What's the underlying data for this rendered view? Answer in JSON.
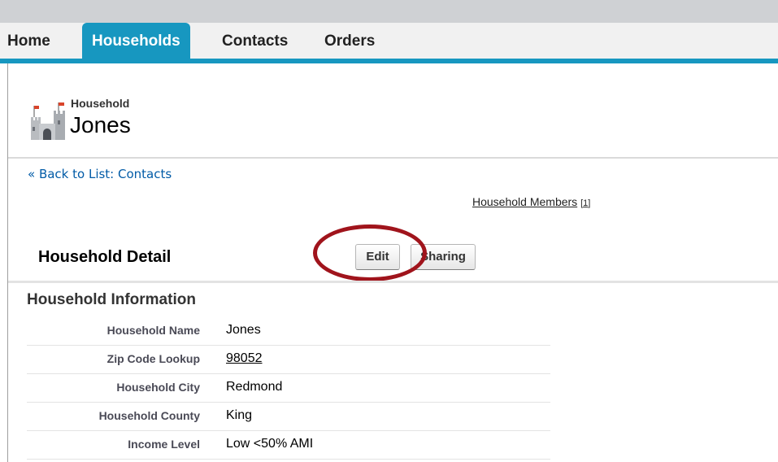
{
  "nav": {
    "tabs": [
      {
        "label": "Home"
      },
      {
        "label": "Households"
      },
      {
        "label": "Contacts"
      },
      {
        "label": "Orders"
      }
    ],
    "active_tab": "Households",
    "accent_color": "#1797c0"
  },
  "header": {
    "icon": "castle-icon",
    "subtitle": "Household",
    "title": "Jones"
  },
  "back_link": "« Back to List: Contacts",
  "related": {
    "members_label": "Household Members",
    "members_count_open": "[",
    "members_count": "1",
    "members_count_close": "]"
  },
  "detail": {
    "title": "Household Detail",
    "edit_label": "Edit",
    "sharing_label": "Sharing",
    "highlight_color": "#a0141c"
  },
  "info": {
    "section_title": "Household Information",
    "fields": [
      {
        "label": "Household Name",
        "value": "Jones"
      },
      {
        "label": "Zip Code Lookup",
        "value": "98052"
      },
      {
        "label": "Household City",
        "value": "Redmond"
      },
      {
        "label": "Household County",
        "value": "King"
      },
      {
        "label": "Income Level",
        "value": "Low <50% AMI"
      }
    ]
  }
}
